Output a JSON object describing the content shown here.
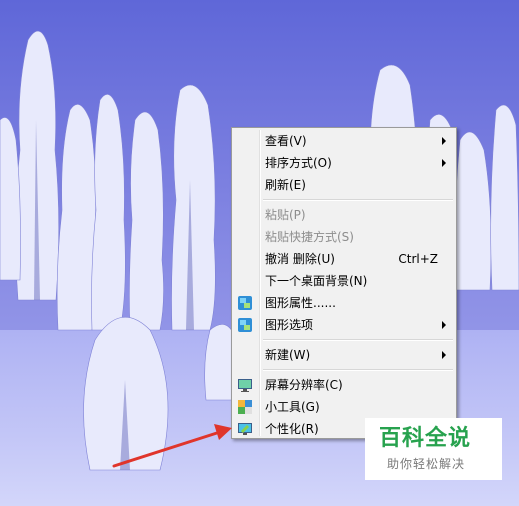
{
  "context_menu": {
    "items": [
      {
        "label": "查看(V)",
        "submenu": true,
        "enabled": true
      },
      {
        "label": "排序方式(O)",
        "submenu": true,
        "enabled": true
      },
      {
        "label": "刷新(E)",
        "submenu": false,
        "enabled": true
      },
      {
        "label": "粘贴(P)",
        "submenu": false,
        "enabled": false
      },
      {
        "label": "粘贴快捷方式(S)",
        "submenu": false,
        "enabled": false
      },
      {
        "label": "撤消 删除(U)",
        "shortcut": "Ctrl+Z",
        "submenu": false,
        "enabled": true
      },
      {
        "label": "下一个桌面背景(N)",
        "submenu": false,
        "enabled": true
      },
      {
        "label": "图形属性......",
        "icon": "graphics-properties-icon",
        "submenu": false,
        "enabled": true
      },
      {
        "label": "图形选项",
        "icon": "graphics-options-icon",
        "submenu": true,
        "enabled": true
      },
      {
        "label": "新建(W)",
        "submenu": true,
        "enabled": true
      },
      {
        "label": "屏幕分辨率(C)",
        "icon": "screen-resolution-icon",
        "submenu": false,
        "enabled": true
      },
      {
        "label": "小工具(G)",
        "icon": "gadgets-icon",
        "submenu": false,
        "enabled": true
      },
      {
        "label": "个性化(R)",
        "icon": "personalize-icon",
        "submenu": false,
        "enabled": true
      }
    ]
  },
  "watermark": {
    "title": "百科全说",
    "subtitle": "助你轻松解决"
  },
  "colors": {
    "annotation_arrow": "#e0352b",
    "watermark_green": "#27a24e",
    "menu_background": "#f1f1f1"
  }
}
